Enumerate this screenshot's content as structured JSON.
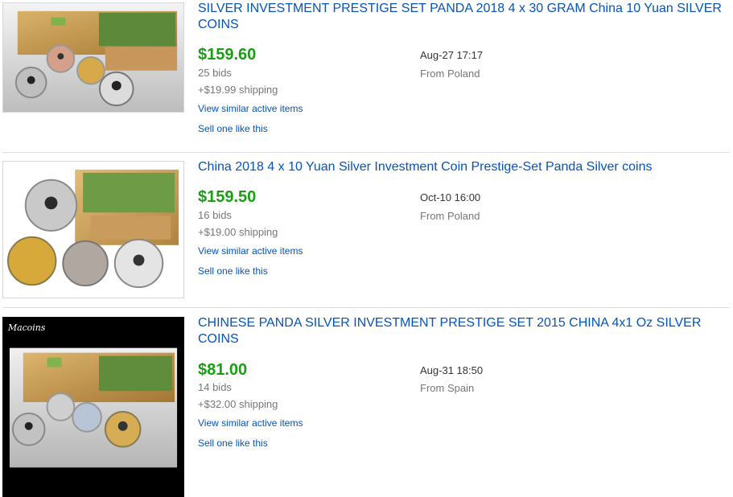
{
  "listings": [
    {
      "image_alt": "panda-prestige-set-photo",
      "title": "SILVER INVESTMENT PRESTIGE SET PANDA 2018 4 x 30 GRAM China 10 Yuan SILVER COINS",
      "price": "$159.60",
      "bids": "25 bids",
      "shipping": "+$19.99 shipping",
      "date": "Aug-27 17:17",
      "origin": "From Poland",
      "similar_link": "View similar active items",
      "sell_link": "Sell one like this"
    },
    {
      "image_alt": "panda-coins-set-photo",
      "title": "China 2018 4 x 10 Yuan Silver Investment Coin Prestige-Set Panda Silver coins",
      "price": "$159.50",
      "bids": "16 bids",
      "shipping": "+$19.00 shipping",
      "date": "Oct-10 16:00",
      "origin": "From Poland",
      "similar_link": "View similar active items",
      "sell_link": "Sell one like this"
    },
    {
      "image_alt": "macoins-panda-set-photo",
      "watermark": "Macoins",
      "title": "CHINESE PANDA SILVER INVESTMENT PRESTIGE SET 2015 CHINA 4x1 Oz SILVER COINS",
      "price": "$81.00",
      "bids": "14 bids",
      "shipping": "+$32.00 shipping",
      "date": "Aug-31 18:50",
      "origin": "From Spain",
      "similar_link": "View similar active items",
      "sell_link": "Sell one like this"
    }
  ],
  "colors": {
    "title_link": "#0654ba",
    "price": "#1a9e12",
    "muted": "#777777"
  }
}
